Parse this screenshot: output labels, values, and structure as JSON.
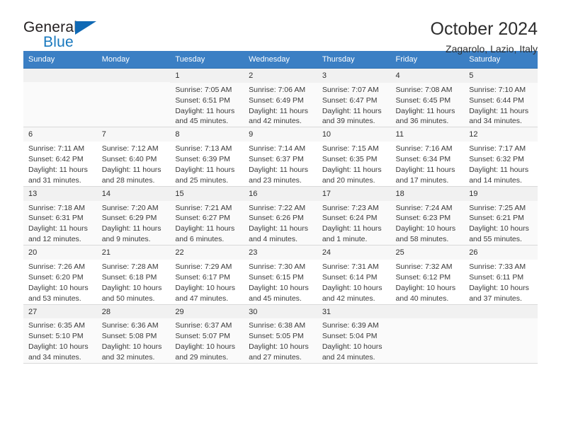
{
  "brand": {
    "word_one": "General",
    "word_two": "Blue",
    "logo_icon": "triangle-logo-icon",
    "primary_color": "#1069b4"
  },
  "header": {
    "title": "October 2024",
    "location": "Zagarolo, Lazio, Italy"
  },
  "calendar": {
    "header_color": "#3b7fc4",
    "weekdays": [
      "Sunday",
      "Monday",
      "Tuesday",
      "Wednesday",
      "Thursday",
      "Friday",
      "Saturday"
    ],
    "weeks": [
      [
        {
          "day": "",
          "sunrise": "",
          "sunset": "",
          "daylight": "",
          "empty": true
        },
        {
          "day": "",
          "sunrise": "",
          "sunset": "",
          "daylight": "",
          "empty": true
        },
        {
          "day": "1",
          "sunrise": "Sunrise: 7:05 AM",
          "sunset": "Sunset: 6:51 PM",
          "daylight": "Daylight: 11 hours and 45 minutes."
        },
        {
          "day": "2",
          "sunrise": "Sunrise: 7:06 AM",
          "sunset": "Sunset: 6:49 PM",
          "daylight": "Daylight: 11 hours and 42 minutes."
        },
        {
          "day": "3",
          "sunrise": "Sunrise: 7:07 AM",
          "sunset": "Sunset: 6:47 PM",
          "daylight": "Daylight: 11 hours and 39 minutes."
        },
        {
          "day": "4",
          "sunrise": "Sunrise: 7:08 AM",
          "sunset": "Sunset: 6:45 PM",
          "daylight": "Daylight: 11 hours and 36 minutes."
        },
        {
          "day": "5",
          "sunrise": "Sunrise: 7:10 AM",
          "sunset": "Sunset: 6:44 PM",
          "daylight": "Daylight: 11 hours and 34 minutes."
        }
      ],
      [
        {
          "day": "6",
          "sunrise": "Sunrise: 7:11 AM",
          "sunset": "Sunset: 6:42 PM",
          "daylight": "Daylight: 11 hours and 31 minutes."
        },
        {
          "day": "7",
          "sunrise": "Sunrise: 7:12 AM",
          "sunset": "Sunset: 6:40 PM",
          "daylight": "Daylight: 11 hours and 28 minutes."
        },
        {
          "day": "8",
          "sunrise": "Sunrise: 7:13 AM",
          "sunset": "Sunset: 6:39 PM",
          "daylight": "Daylight: 11 hours and 25 minutes."
        },
        {
          "day": "9",
          "sunrise": "Sunrise: 7:14 AM",
          "sunset": "Sunset: 6:37 PM",
          "daylight": "Daylight: 11 hours and 23 minutes."
        },
        {
          "day": "10",
          "sunrise": "Sunrise: 7:15 AM",
          "sunset": "Sunset: 6:35 PM",
          "daylight": "Daylight: 11 hours and 20 minutes."
        },
        {
          "day": "11",
          "sunrise": "Sunrise: 7:16 AM",
          "sunset": "Sunset: 6:34 PM",
          "daylight": "Daylight: 11 hours and 17 minutes."
        },
        {
          "day": "12",
          "sunrise": "Sunrise: 7:17 AM",
          "sunset": "Sunset: 6:32 PM",
          "daylight": "Daylight: 11 hours and 14 minutes."
        }
      ],
      [
        {
          "day": "13",
          "sunrise": "Sunrise: 7:18 AM",
          "sunset": "Sunset: 6:31 PM",
          "daylight": "Daylight: 11 hours and 12 minutes."
        },
        {
          "day": "14",
          "sunrise": "Sunrise: 7:20 AM",
          "sunset": "Sunset: 6:29 PM",
          "daylight": "Daylight: 11 hours and 9 minutes."
        },
        {
          "day": "15",
          "sunrise": "Sunrise: 7:21 AM",
          "sunset": "Sunset: 6:27 PM",
          "daylight": "Daylight: 11 hours and 6 minutes."
        },
        {
          "day": "16",
          "sunrise": "Sunrise: 7:22 AM",
          "sunset": "Sunset: 6:26 PM",
          "daylight": "Daylight: 11 hours and 4 minutes."
        },
        {
          "day": "17",
          "sunrise": "Sunrise: 7:23 AM",
          "sunset": "Sunset: 6:24 PM",
          "daylight": "Daylight: 11 hours and 1 minute."
        },
        {
          "day": "18",
          "sunrise": "Sunrise: 7:24 AM",
          "sunset": "Sunset: 6:23 PM",
          "daylight": "Daylight: 10 hours and 58 minutes."
        },
        {
          "day": "19",
          "sunrise": "Sunrise: 7:25 AM",
          "sunset": "Sunset: 6:21 PM",
          "daylight": "Daylight: 10 hours and 55 minutes."
        }
      ],
      [
        {
          "day": "20",
          "sunrise": "Sunrise: 7:26 AM",
          "sunset": "Sunset: 6:20 PM",
          "daylight": "Daylight: 10 hours and 53 minutes."
        },
        {
          "day": "21",
          "sunrise": "Sunrise: 7:28 AM",
          "sunset": "Sunset: 6:18 PM",
          "daylight": "Daylight: 10 hours and 50 minutes."
        },
        {
          "day": "22",
          "sunrise": "Sunrise: 7:29 AM",
          "sunset": "Sunset: 6:17 PM",
          "daylight": "Daylight: 10 hours and 47 minutes."
        },
        {
          "day": "23",
          "sunrise": "Sunrise: 7:30 AM",
          "sunset": "Sunset: 6:15 PM",
          "daylight": "Daylight: 10 hours and 45 minutes."
        },
        {
          "day": "24",
          "sunrise": "Sunrise: 7:31 AM",
          "sunset": "Sunset: 6:14 PM",
          "daylight": "Daylight: 10 hours and 42 minutes."
        },
        {
          "day": "25",
          "sunrise": "Sunrise: 7:32 AM",
          "sunset": "Sunset: 6:12 PM",
          "daylight": "Daylight: 10 hours and 40 minutes."
        },
        {
          "day": "26",
          "sunrise": "Sunrise: 7:33 AM",
          "sunset": "Sunset: 6:11 PM",
          "daylight": "Daylight: 10 hours and 37 minutes."
        }
      ],
      [
        {
          "day": "27",
          "sunrise": "Sunrise: 6:35 AM",
          "sunset": "Sunset: 5:10 PM",
          "daylight": "Daylight: 10 hours and 34 minutes."
        },
        {
          "day": "28",
          "sunrise": "Sunrise: 6:36 AM",
          "sunset": "Sunset: 5:08 PM",
          "daylight": "Daylight: 10 hours and 32 minutes."
        },
        {
          "day": "29",
          "sunrise": "Sunrise: 6:37 AM",
          "sunset": "Sunset: 5:07 PM",
          "daylight": "Daylight: 10 hours and 29 minutes."
        },
        {
          "day": "30",
          "sunrise": "Sunrise: 6:38 AM",
          "sunset": "Sunset: 5:05 PM",
          "daylight": "Daylight: 10 hours and 27 minutes."
        },
        {
          "day": "31",
          "sunrise": "Sunrise: 6:39 AM",
          "sunset": "Sunset: 5:04 PM",
          "daylight": "Daylight: 10 hours and 24 minutes."
        },
        {
          "day": "",
          "sunrise": "",
          "sunset": "",
          "daylight": "",
          "empty": true
        },
        {
          "day": "",
          "sunrise": "",
          "sunset": "",
          "daylight": "",
          "empty": true
        }
      ]
    ]
  }
}
